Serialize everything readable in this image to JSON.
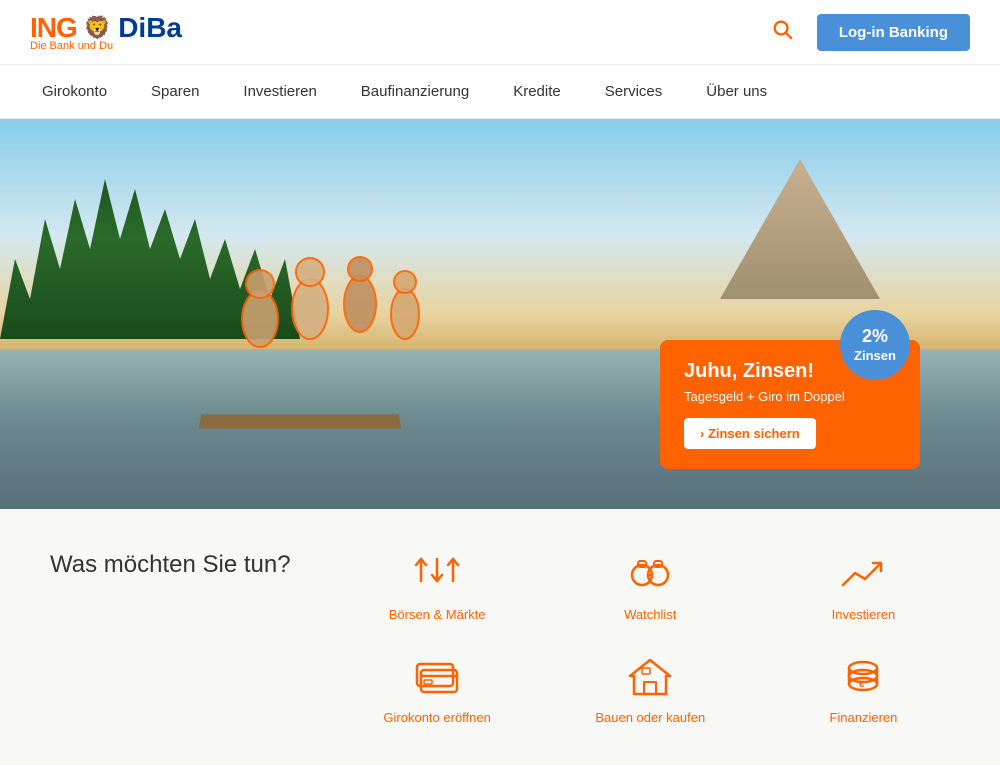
{
  "header": {
    "logo_ing": "ING",
    "logo_diba": "DiBa",
    "logo_tagline": "Die Bank und Du",
    "login_label": "Log-in Banking"
  },
  "nav": {
    "items": [
      {
        "label": "Girokonto",
        "id": "girokonto"
      },
      {
        "label": "Sparen",
        "id": "sparen"
      },
      {
        "label": "Investieren",
        "id": "investieren"
      },
      {
        "label": "Baufinanzierung",
        "id": "baufinanzierung"
      },
      {
        "label": "Kredite",
        "id": "kredite"
      },
      {
        "label": "Services",
        "id": "services"
      },
      {
        "label": "Über uns",
        "id": "ueber-uns"
      }
    ]
  },
  "promo": {
    "badge_percent": "2%",
    "badge_label": "Zinsen",
    "title": "Juhu, Zinsen!",
    "subtitle": "Tagesgeld + Giro im Doppel",
    "button_label": "› Zinsen sichern"
  },
  "actions": {
    "title": "Was möchten Sie tun?",
    "items": [
      {
        "id": "boersen-maerkte",
        "label": "Börsen & Märkte",
        "icon": "arrows-updown"
      },
      {
        "id": "watchlist",
        "label": "Watchlist",
        "icon": "binoculars"
      },
      {
        "id": "investieren",
        "label": "Investieren",
        "icon": "trend-up"
      },
      {
        "id": "girokonto-eroeffnen",
        "label": "Girokonto eröffnen",
        "icon": "cards"
      },
      {
        "id": "bauen-kaufen",
        "label": "Bauen oder kaufen",
        "icon": "house"
      },
      {
        "id": "finanzieren",
        "label": "Finanzieren",
        "icon": "coins"
      }
    ]
  }
}
